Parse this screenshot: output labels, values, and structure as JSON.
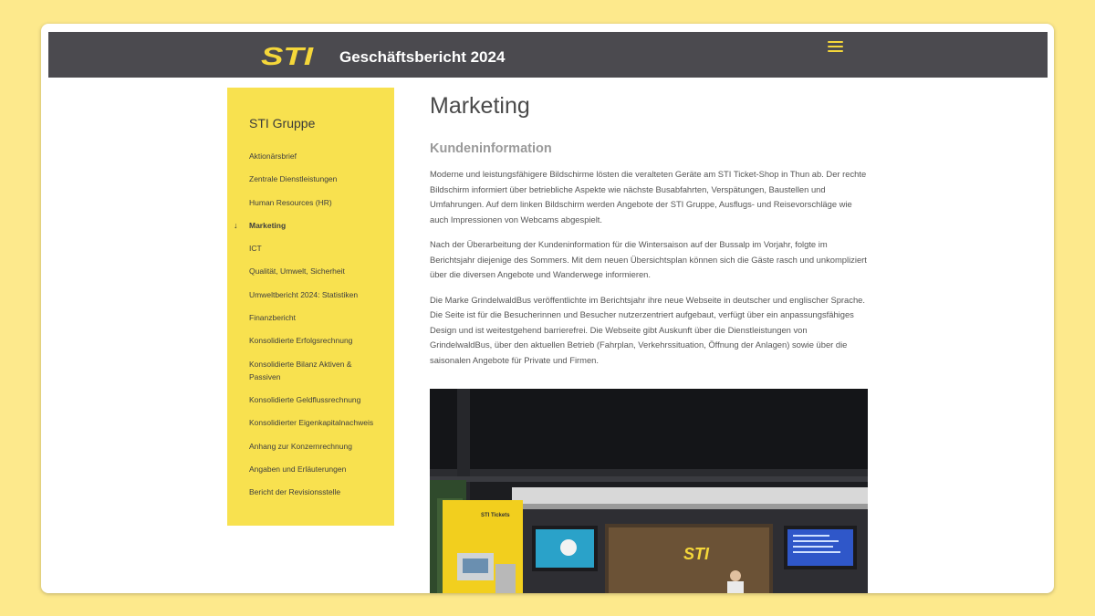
{
  "header": {
    "logo_text": "STI",
    "title": "Geschäftsbericht 2024",
    "menu_icon": "hamburger-icon"
  },
  "sidebar": {
    "heading": "STI Gruppe",
    "items": [
      {
        "label": "Aktionärsbrief"
      },
      {
        "label": "Zentrale Dienstleistungen"
      },
      {
        "label": "Human Resources (HR)"
      },
      {
        "label": "Marketing",
        "active": true
      },
      {
        "label": "ICT"
      },
      {
        "label": "Qualität, Umwelt, Sicherheit"
      },
      {
        "label": "Umweltbericht 2024: Statistiken"
      },
      {
        "label": "Finanzbericht"
      },
      {
        "label": "Konsolidierte Erfolgsrechnung"
      },
      {
        "label": "Konsolidierte Bilanz Aktiven & Passiven"
      },
      {
        "label": "Konsolidierte Geldflussrechnung"
      },
      {
        "label": "Konsolidierter Eigenkapitalnachweis"
      },
      {
        "label": "Anhang zur Konzernrechnung"
      },
      {
        "label": "Angaben und Erläuterungen"
      },
      {
        "label": "Bericht der Revisionsstelle"
      }
    ],
    "active_marker": "↓"
  },
  "main": {
    "page_title": "Marketing",
    "section_title": "Kundeninformation",
    "paragraphs": [
      "Moderne und leistungsfähigere Bildschirme lösten die veralteten Geräte am STI Ticket-Shop in Thun ab. Der rechte Bildschirm informiert über betriebliche Aspekte wie nächste Busabfahrten, Verspätungen, Baustellen und Umfahrungen. Auf dem linken Bildschirm werden Angebote der STI Gruppe, Ausflugs- und Reisevorschläge wie auch Impressionen von Webcams abgespielt.",
      "Nach der Überarbeitung der Kundeninformation für die Wintersaison auf der Bussalp im Vorjahr, folgte im Berichtsjahr diejenige des Sommers. Mit dem neuen Übersichtsplan können sich die Gäste rasch und unkompliziert über die diversen Angebote und Wanderwege informieren.",
      "Die Marke GrindelwaldBus veröffentlichte im Berichtsjahr ihre neue Webseite in deutscher und englischer Sprache. Die Seite ist für die Besucherinnen und Besucher nutzerzentriert aufgebaut, verfügt über ein anpassungsfähiges Design und ist weitestgehend barrierefrei. Die Webseite gibt Auskunft über die Dienstleistungen von GrindelwaldBus, über den aktuellen Betrieb (Fahrplan, Verkehrssituation, Öffnung der Anlagen) sowie über die saisonalen Angebote für Private und Firmen."
    ],
    "photo": {
      "kiosk_label": "STI Tickets",
      "shop_logo": "STI"
    }
  },
  "colors": {
    "page_background": "#fde98c",
    "topbar": "#4b4a4f",
    "accent_yellow": "#f8e14f",
    "logo_yellow": "#f5d73a"
  }
}
